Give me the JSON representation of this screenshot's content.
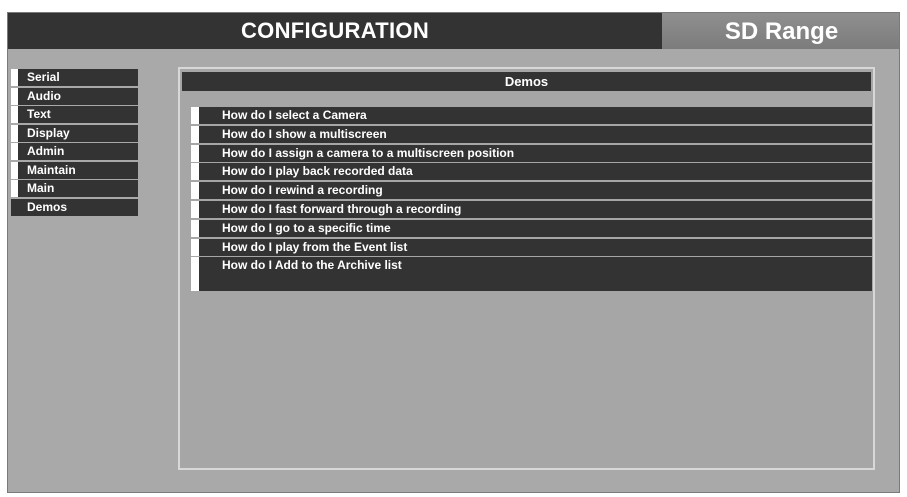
{
  "header": {
    "title": "CONFIGURATION",
    "brand": "SD Range"
  },
  "sidebar": {
    "items": [
      {
        "label": "Serial"
      },
      {
        "label": "Audio"
      },
      {
        "label": "Text"
      },
      {
        "label": "Display"
      },
      {
        "label": "Admin"
      },
      {
        "label": "Maintain"
      },
      {
        "label": "Main"
      },
      {
        "label": "Demos"
      }
    ],
    "active": "Demos"
  },
  "panel": {
    "title": "Demos",
    "items": [
      {
        "label": "How do I select a Camera"
      },
      {
        "label": "How do I show a multiscreen"
      },
      {
        "label": "How do I assign a camera to a multiscreen position"
      },
      {
        "label": "How do I play back recorded data"
      },
      {
        "label": "How do I rewind a recording"
      },
      {
        "label": "How do I fast forward through a recording"
      },
      {
        "label": "How do I go to a specific time"
      },
      {
        "label": "How do I play from the Event list"
      },
      {
        "label": "How do I Add to the Archive list"
      }
    ]
  }
}
